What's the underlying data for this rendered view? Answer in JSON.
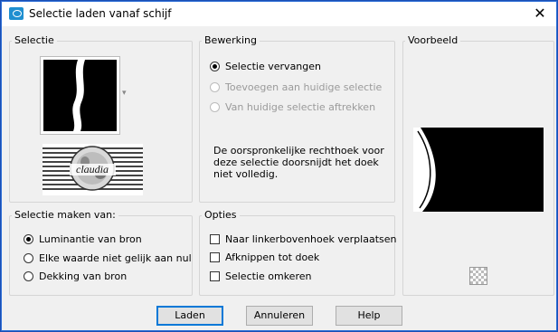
{
  "window": {
    "title": "Selectie laden vanaf schijf",
    "close_glyph": "✕"
  },
  "selectie": {
    "label": "Selectie",
    "dropdown_glyph": "▾",
    "logo_text": "claudia"
  },
  "bewerking": {
    "label": "Bewerking",
    "options": [
      {
        "label": "Selectie vervangen",
        "selected": true,
        "enabled": true
      },
      {
        "label": "Toevoegen aan huidige selectie",
        "selected": false,
        "enabled": false
      },
      {
        "label": "Van huidige selectie aftrekken",
        "selected": false,
        "enabled": false
      }
    ],
    "note_line1": "De oorspronkelijke rechthoek voor",
    "note_line2": "deze selectie doorsnijdt het doek",
    "note_line3": "niet volledig."
  },
  "voorbeeld": {
    "label": "Voorbeeld"
  },
  "bron": {
    "label": "Selectie maken van:",
    "options": [
      {
        "label": "Luminantie van bron",
        "selected": true
      },
      {
        "label": "Elke waarde niet gelijk aan nul",
        "selected": false
      },
      {
        "label": "Dekking van bron",
        "selected": false
      }
    ]
  },
  "opties": {
    "label": "Opties",
    "items": [
      {
        "label": "Naar linkerbovenhoek verplaatsen",
        "checked": false
      },
      {
        "label": "Afknippen tot doek",
        "checked": false
      },
      {
        "label": "Selectie omkeren",
        "checked": false
      }
    ]
  },
  "buttons": {
    "load": "Laden",
    "cancel": "Annuleren",
    "help": "Help"
  }
}
